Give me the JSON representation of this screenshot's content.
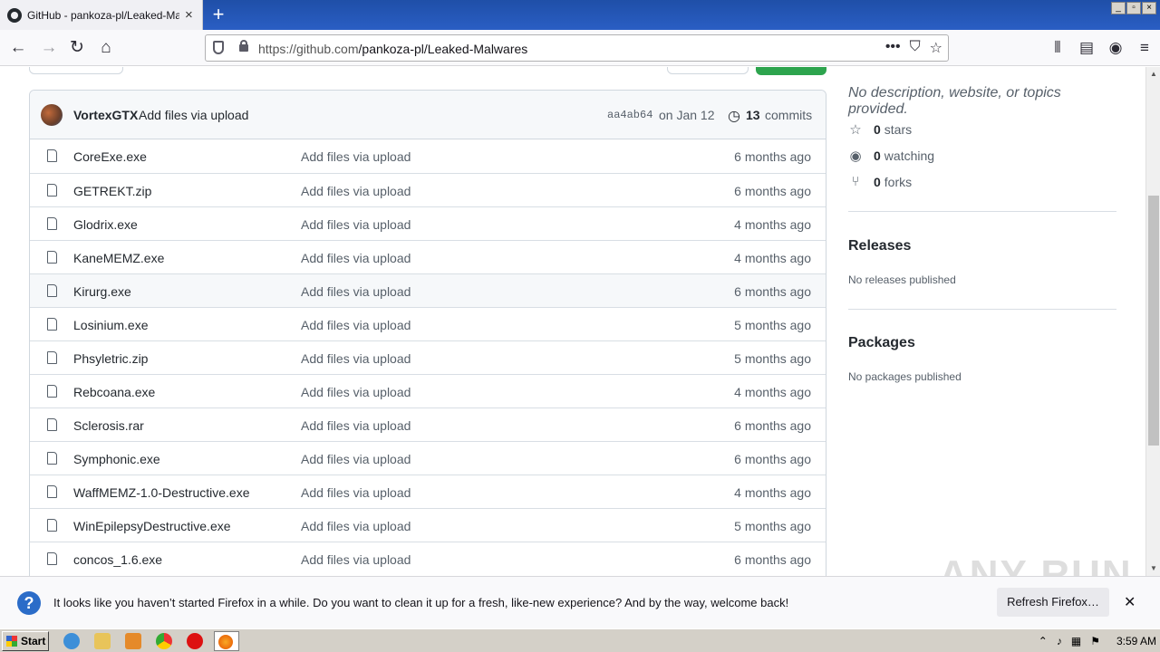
{
  "browser": {
    "tab_title": "GitHub - pankoza-pl/Leaked-Malwares",
    "tab_close": "×",
    "new_tab": "+",
    "url_host": "https://github.com",
    "url_path": "/pankoza-pl/Leaked-Malwares",
    "win_min": "_",
    "win_max": "▫",
    "win_close": "×"
  },
  "commit": {
    "author": "VortexGTX",
    "message": "Add files via upload",
    "sha": "aa4ab64",
    "date": "on Jan 12",
    "count": "13",
    "label": "commits"
  },
  "files": [
    {
      "name": "CoreExe.exe",
      "message": "Add files via upload",
      "age": "6 months ago"
    },
    {
      "name": "GETREKT.zip",
      "message": "Add files via upload",
      "age": "6 months ago"
    },
    {
      "name": "Glodrix.exe",
      "message": "Add files via upload",
      "age": "4 months ago"
    },
    {
      "name": "KaneMEMZ.exe",
      "message": "Add files via upload",
      "age": "4 months ago"
    },
    {
      "name": "Kirurg.exe",
      "message": "Add files via upload",
      "age": "6 months ago"
    },
    {
      "name": "Losinium.exe",
      "message": "Add files via upload",
      "age": "5 months ago"
    },
    {
      "name": "Phsyletric.zip",
      "message": "Add files via upload",
      "age": "5 months ago"
    },
    {
      "name": "Rebcoana.exe",
      "message": "Add files via upload",
      "age": "4 months ago"
    },
    {
      "name": "Sclerosis.rar",
      "message": "Add files via upload",
      "age": "6 months ago"
    },
    {
      "name": "Symphonic.exe",
      "message": "Add files via upload",
      "age": "6 months ago"
    },
    {
      "name": "WaffMEMZ-1.0-Destructive.exe",
      "message": "Add files via upload",
      "age": "4 months ago"
    },
    {
      "name": "WinEpilepsyDestructive.exe",
      "message": "Add files via upload",
      "age": "5 months ago"
    },
    {
      "name": "concos_1.6.exe",
      "message": "Add files via upload",
      "age": "6 months ago"
    }
  ],
  "sidebar": {
    "about": "No description, website, or topics provided.",
    "stars_count": "0",
    "stars_label": "stars",
    "watching_count": "0",
    "watching_label": "watching",
    "forks_count": "0",
    "forks_label": "forks",
    "releases_title": "Releases",
    "releases_empty": "No releases published",
    "packages_title": "Packages",
    "packages_empty": "No packages published"
  },
  "notification": {
    "text": "It looks like you haven’t started Firefox in a while. Do you want to clean it up for a fresh, like-new experience? And by the way, welcome back!",
    "button": "Refresh Firefox…",
    "close": "✕"
  },
  "watermark": "ANY RUN",
  "taskbar": {
    "start": "Start",
    "clock": "3:59 AM"
  },
  "colors": {
    "link_green": "#2da44e",
    "titlebar_blue": "#2a5ec4",
    "notification_icon": "#2b6cc8"
  }
}
